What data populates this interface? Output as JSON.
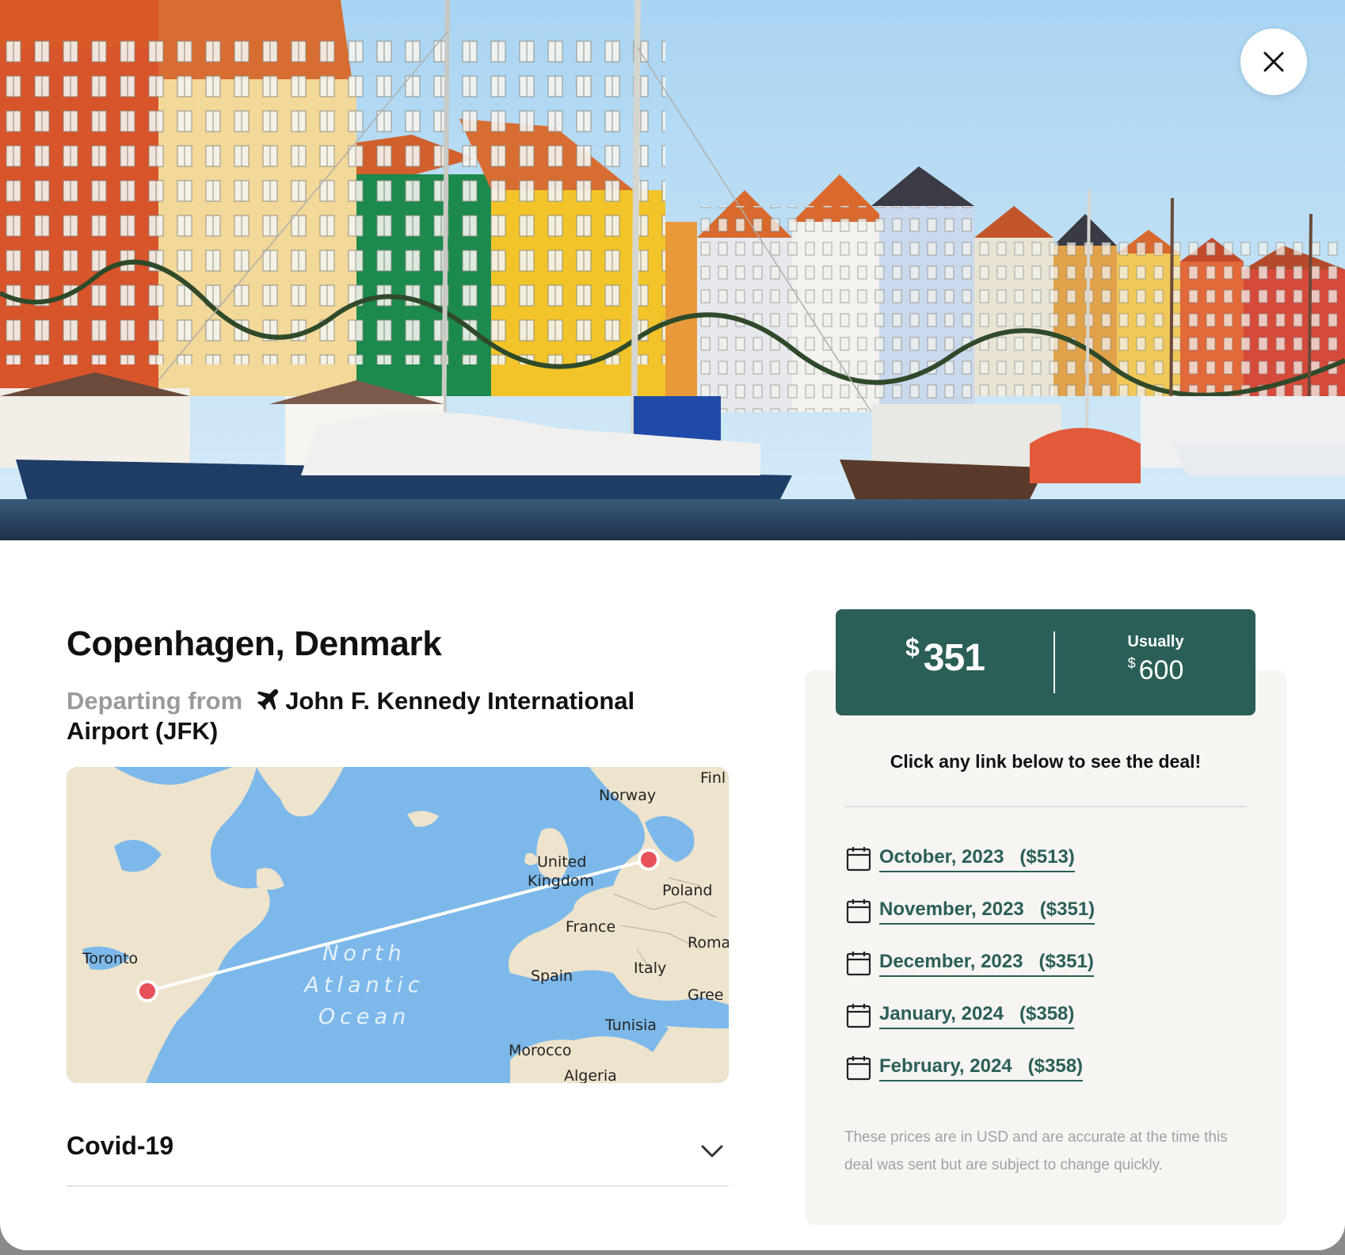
{
  "destination": {
    "title": "Copenhagen, Denmark",
    "departing_label": "Departing from",
    "airport": "John F. Kennedy International Airport (JFK)"
  },
  "hero": {
    "image": "Nyhavn harbor with colorful buildings and sailing ships",
    "close_icon": "close-icon"
  },
  "map": {
    "labels": {
      "norway": "Norway",
      "finland": "Finl",
      "uk_line1": "United",
      "uk_line2": "Kingdom",
      "poland": "Poland",
      "france": "France",
      "romania": "Roma",
      "toronto": "Toronto",
      "italy": "Italy",
      "spain": "Spain",
      "greece": "Gree",
      "tunisia": "Tunisia",
      "morocco": "Morocco",
      "algeria": "Algeria",
      "ocean_1": "North",
      "ocean_2": "Atlantic",
      "ocean_3": "Ocean"
    },
    "colors": {
      "water": "#7cb9ea",
      "land": "#eee3cc",
      "pin": "#e8515a"
    }
  },
  "covid": {
    "label": "Covid-19",
    "icon": "chevron-down-icon"
  },
  "price": {
    "currency": "$",
    "amount": "351",
    "usually_label": "Usually",
    "usual_amount": "600",
    "color": "#2a5f58"
  },
  "deals": {
    "cta": "Click any link below to see the deal!",
    "items": [
      {
        "label": "October, 2023   ($513)"
      },
      {
        "label": "November, 2023   ($351)"
      },
      {
        "label": "December, 2023   ($351)"
      },
      {
        "label": "January, 2024   ($358)"
      },
      {
        "label": "February, 2024   ($358)"
      }
    ],
    "note": "These prices are in USD and are accurate at the time this deal was sent but are subject to change quickly."
  }
}
